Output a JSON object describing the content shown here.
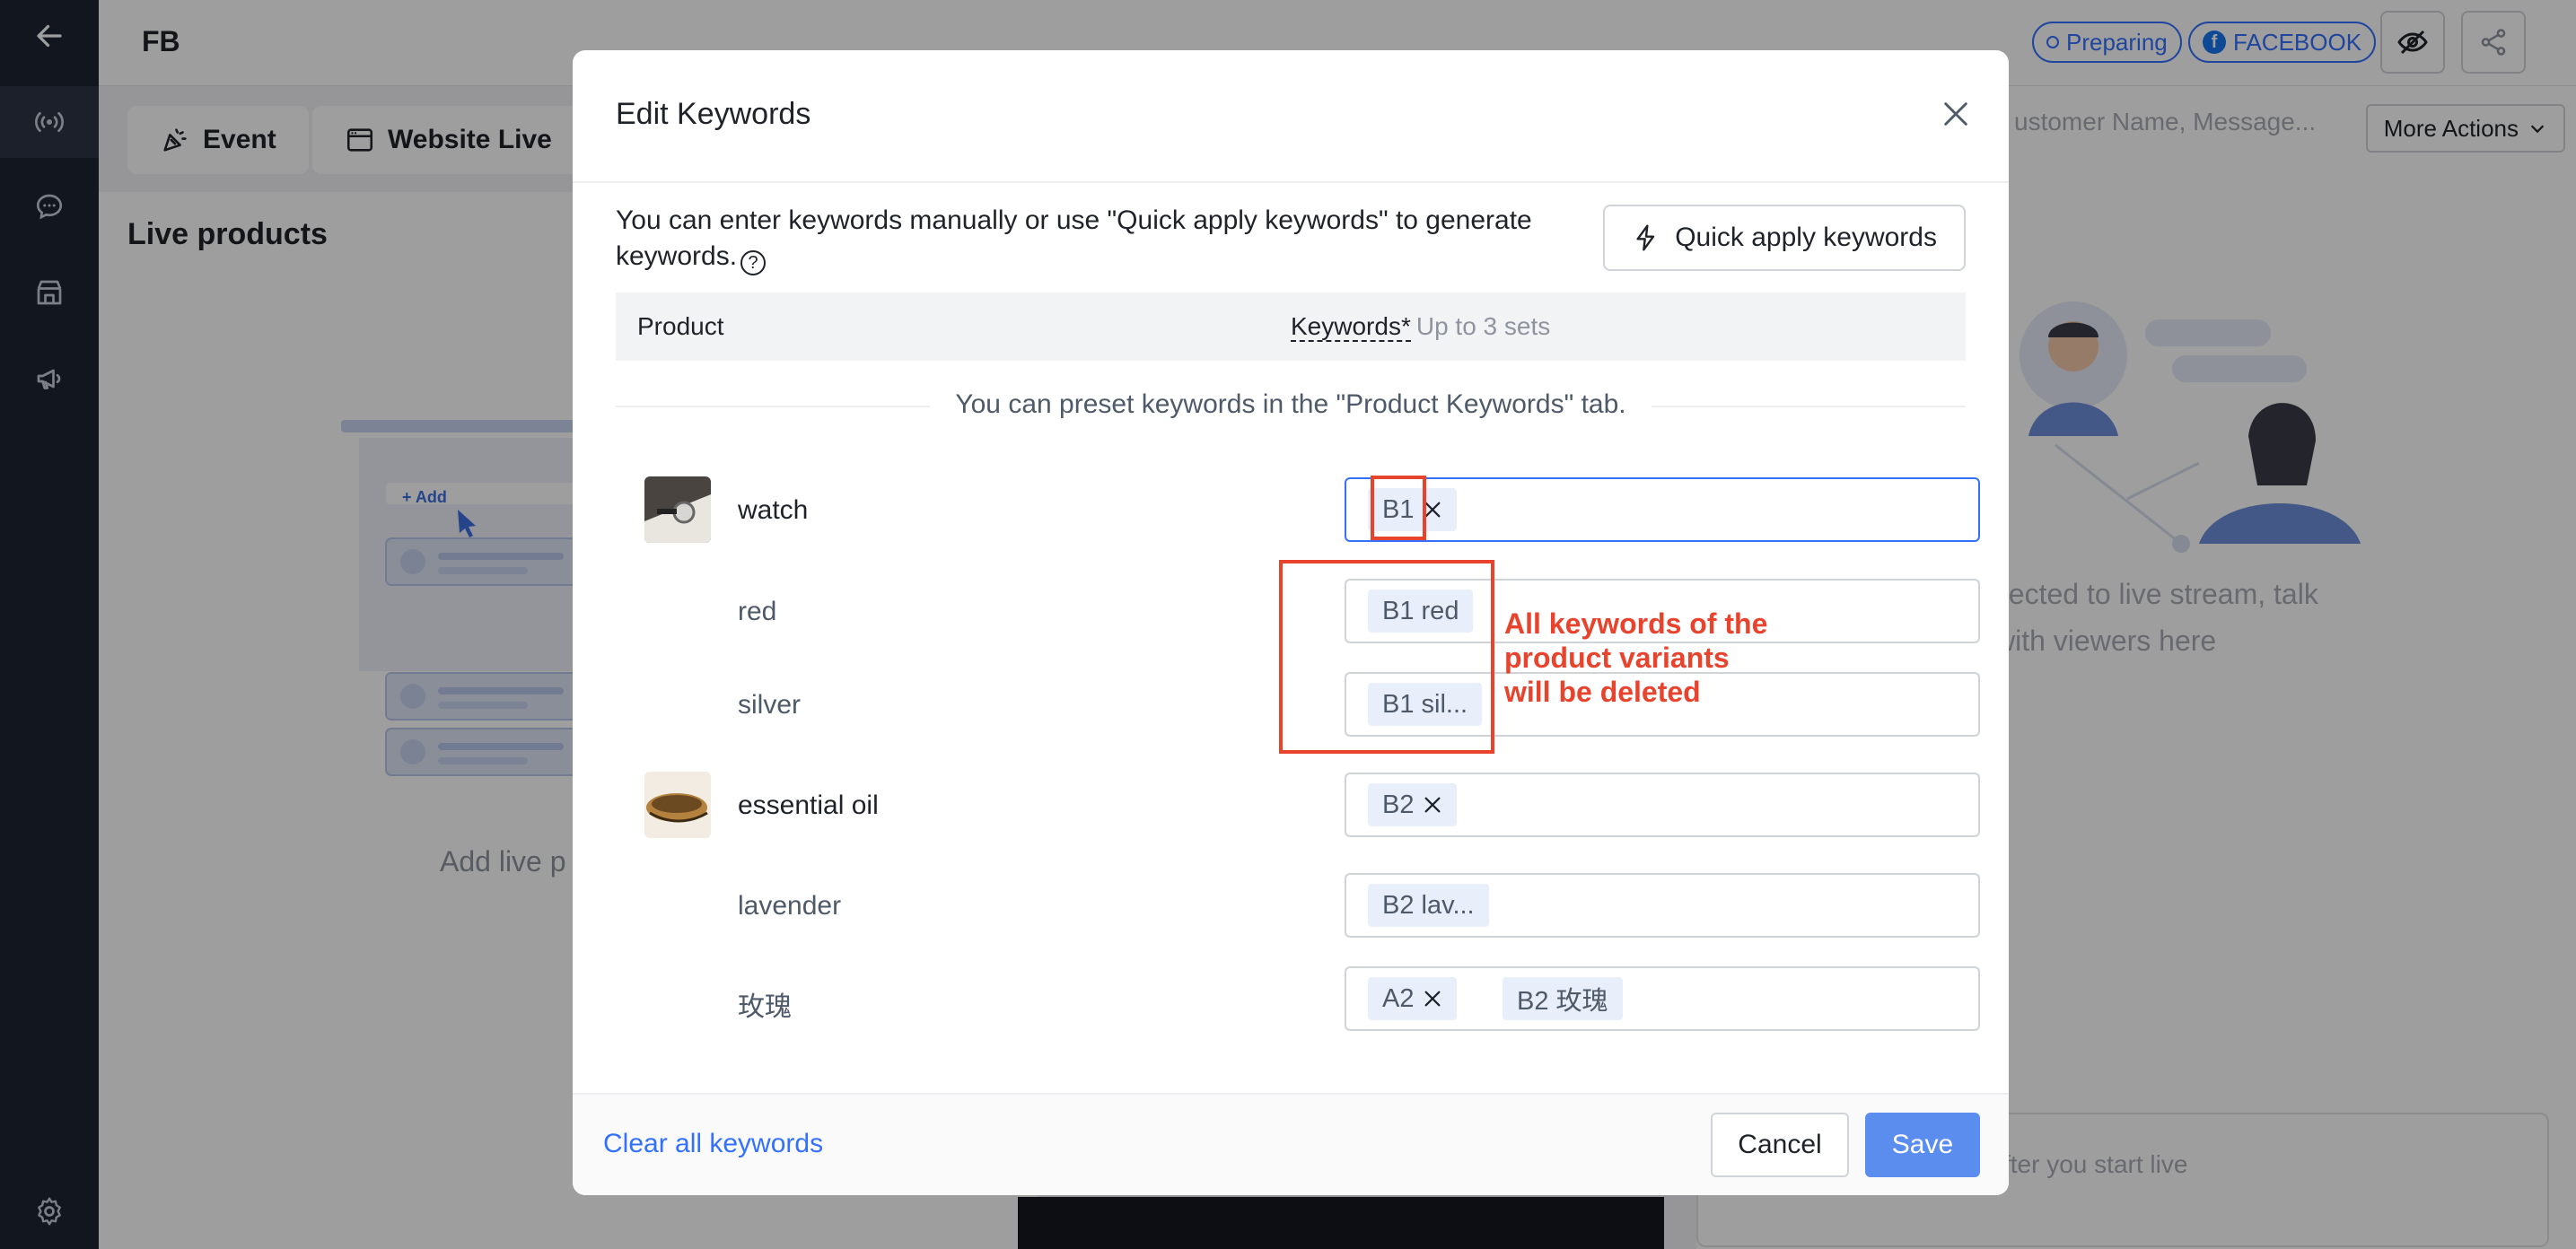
{
  "topbar": {
    "title": "FB",
    "status_badge": "Preparing",
    "platform_badge": "FACEBOOK"
  },
  "tabs": [
    {
      "label": "Event",
      "icon": "party-popper-icon"
    },
    {
      "label": "Website Live",
      "icon": "browser-window-icon"
    }
  ],
  "left_panel": {
    "title": "Live products",
    "illustration_button": "+ Add",
    "empty_text": "Add live p"
  },
  "right_panel": {
    "search_placeholder": "ustomer Name, Message...",
    "more_actions": "More Actions",
    "empty_line1": "nected to live stream, talk",
    "empty_line2": "with viewers here",
    "input_placeholder": "fter you start live"
  },
  "modal": {
    "title": "Edit Keywords",
    "intro": "You can enter keywords manually or use \"Quick apply keywords\" to generate keywords.",
    "quick_apply": "Quick apply keywords",
    "col_product": "Product",
    "col_keywords": "Keywords*",
    "col_keywords_hint": "Up to 3 sets",
    "preset_hint": "You can preset keywords in the \"Product Keywords\" tab.",
    "rows": [
      {
        "name": "watch",
        "thumb": "watch",
        "tags": [
          {
            "text": "B1",
            "removable": true
          }
        ]
      },
      {
        "name": "red",
        "tags": [
          {
            "text": "B1 red",
            "removable": false
          }
        ]
      },
      {
        "name": "silver",
        "tags": [
          {
            "text": "B1 sil...",
            "removable": false
          }
        ]
      },
      {
        "name": "essential oil",
        "thumb": "oil",
        "tags": [
          {
            "text": "B2",
            "removable": true
          }
        ]
      },
      {
        "name": "lavender",
        "tags": [
          {
            "text": "B2 lav...",
            "removable": false
          }
        ]
      },
      {
        "name": "玫瑰",
        "tags": [
          {
            "text": "A2",
            "removable": true
          },
          {
            "text": "B2 玫瑰",
            "removable": false
          }
        ]
      }
    ],
    "clear_all": "Clear all keywords",
    "cancel": "Cancel",
    "save": "Save"
  },
  "annotation": {
    "text_line1": "All keywords of the",
    "text_line2": "product variants",
    "text_line3": "will be deleted",
    "color": "#e8432d"
  },
  "colors": {
    "accent": "#3370ff",
    "primary_button": "#5b8def",
    "sidebar": "#1e2433"
  }
}
